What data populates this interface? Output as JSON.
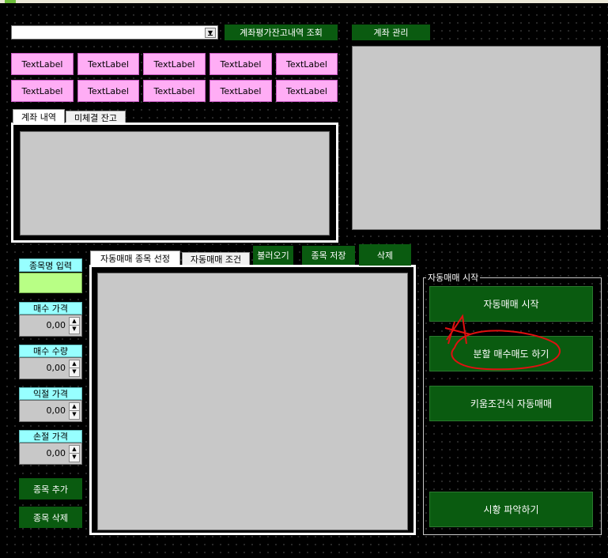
{
  "combo": {
    "value": ""
  },
  "top_buttons": {
    "inquiry": "계좌평가잔고내역 조회",
    "account_mgmt": "계좌 관리"
  },
  "labels_row1": [
    "TextLabel",
    "TextLabel",
    "TextLabel",
    "TextLabel",
    "TextLabel"
  ],
  "labels_row2": [
    "TextLabel",
    "TextLabel",
    "TextLabel",
    "TextLabel",
    "TextLabel"
  ],
  "tabs_top": [
    "계좌 내역",
    "미체결 잔고"
  ],
  "tabs_bottom": [
    "자동매매 종목 선정",
    "자동매매 조건"
  ],
  "mid_buttons": {
    "load": "불러오기",
    "save": "종목 저장",
    "delete": "삭제"
  },
  "left_panel": {
    "name_label": "종목명 입력",
    "buy_price_label": "매수 가격",
    "buy_price_value": "0,00",
    "buy_qty_label": "매수 수량",
    "buy_qty_value": "0,00",
    "profit_label": "익절 가격",
    "profit_value": "0,00",
    "loss_label": "손절 가격",
    "loss_value": "0,00",
    "add_button": "종목 추가",
    "remove_button": "종목 삭제"
  },
  "group": {
    "title": "자동매매 시작",
    "buttons": [
      "자동매매 시작",
      "분할 매수매도 하기",
      "키움조건식 자동매매",
      "시황 파악하기"
    ]
  },
  "colors": {
    "button_green": "#0a5b10",
    "label_pink": "#ffadf5",
    "label_cyan": "#97ffff",
    "input_green": "#b8ff85",
    "annotation_red": "#e01010"
  }
}
